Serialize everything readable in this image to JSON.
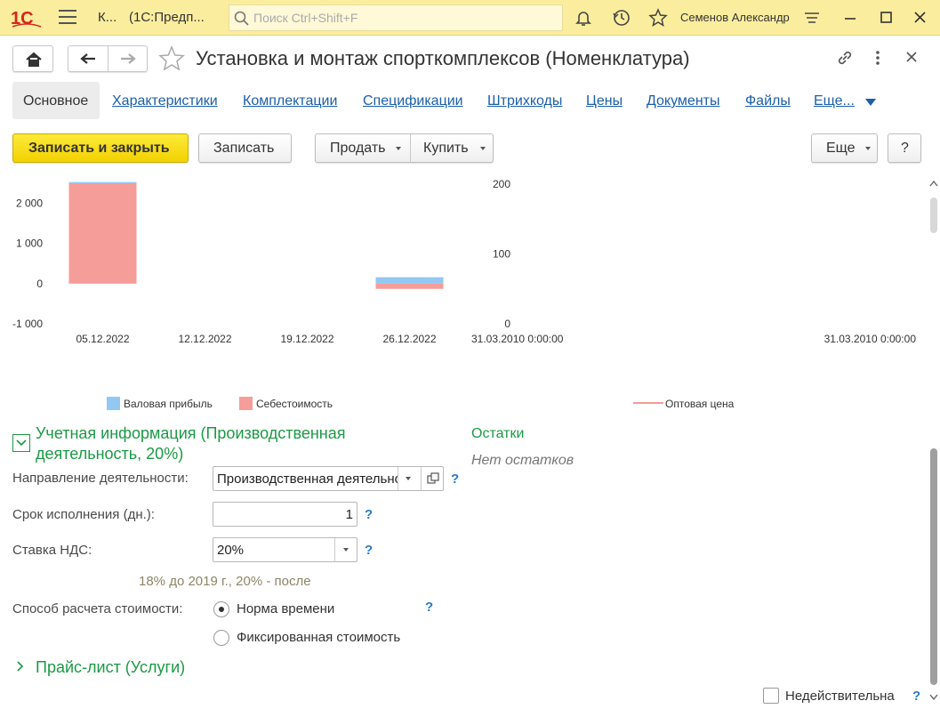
{
  "topbar": {
    "logo_text": "1С",
    "app_title": "К...",
    "app_subtitle": "(1С:Предп...",
    "search_placeholder": "Поиск Ctrl+Shift+F",
    "user_name": "Семенов Александр"
  },
  "header": {
    "title": "Установка и монтаж спорткомплексов (Номенклатура)"
  },
  "tabs": [
    {
      "label": "Основное",
      "active": true
    },
    {
      "label": "Характеристики"
    },
    {
      "label": "Комплектации"
    },
    {
      "label": "Спецификации"
    },
    {
      "label": "Штрихкоды"
    },
    {
      "label": "Цены"
    },
    {
      "label": "Документы"
    },
    {
      "label": "Файлы"
    },
    {
      "label": "Еще..."
    }
  ],
  "commands": {
    "save_close": "Записать и закрыть",
    "save": "Записать",
    "sell": "Продать",
    "buy": "Купить",
    "more": "Еще",
    "help": "?"
  },
  "chart_data": [
    {
      "type": "bar",
      "categories": [
        "05.12.2022",
        "12.12.2022",
        "19.12.2022",
        "26.12.2022"
      ],
      "series": [
        {
          "name": "Валовая прибыль",
          "color": "#92c8f2",
          "values": [
            30,
            0,
            0,
            160
          ]
        },
        {
          "name": "Себестоимость",
          "color": "#f59d99",
          "values": [
            2500,
            0,
            0,
            -130
          ]
        }
      ],
      "yticks": [
        "2 000",
        "1 000",
        "0",
        "-1 000"
      ],
      "ylim": [
        -1000,
        2700
      ],
      "legend": "bottom"
    },
    {
      "type": "line",
      "x": [
        "31.03.2010 0:00:00",
        "31.03.2010 0:00:00"
      ],
      "series": [
        {
          "name": "Оптовая цена",
          "color": "#f29b97",
          "values": []
        }
      ],
      "yticks": [
        "200",
        "100",
        "0"
      ],
      "ylim": [
        0,
        200
      ],
      "legend": "bottom"
    }
  ],
  "accounting": {
    "group_title": "Учетная информация (Производственная деятельность, 20%)",
    "direction_label": "Направление деятельности:",
    "direction_value": "Производственная деятельность",
    "term_label": "Срок исполнения (дн.):",
    "term_value": "1",
    "vat_label": "Ставка НДС:",
    "vat_value": "20%",
    "vat_hint": "18% до 2019 г., 20% - после",
    "cost_method_label": "Способ расчета стоимости:",
    "cost_options": [
      "Норма времени",
      "Фиксированная стоимость"
    ],
    "cost_selected": 0
  },
  "stock": {
    "title": "Остатки",
    "empty_text": "Нет остатков"
  },
  "pricelist": {
    "title": "Прайс-лист (Услуги)"
  },
  "footer": {
    "invalid_label": "Недействительна",
    "help": "?"
  },
  "help_mark": "?"
}
